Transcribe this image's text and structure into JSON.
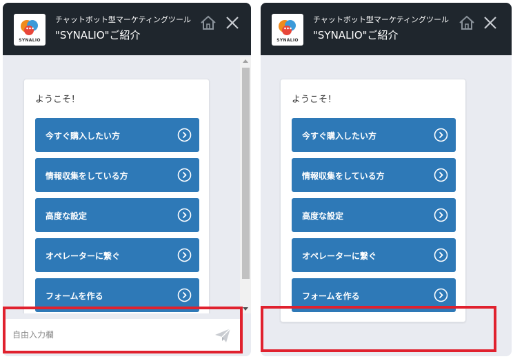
{
  "app": {
    "subtitle": "チャットボット型マーケティングツール",
    "title": "\"SYNALIO\"ご紹介",
    "logo_text": "SYNALIO"
  },
  "chat": {
    "welcome": "ようこそ！",
    "options": [
      {
        "label": "今すぐ購入したい方"
      },
      {
        "label": "情報収集をしている方"
      },
      {
        "label": "高度な設定"
      },
      {
        "label": "オペレーターに繋ぐ"
      },
      {
        "label": "フォームを作る"
      }
    ]
  },
  "input": {
    "placeholder": "自由入力欄"
  },
  "icons": {
    "home": "home-icon",
    "close": "close-icon",
    "send": "send-icon",
    "option_arrow": "chevron-right-circle-icon"
  },
  "colors": {
    "header_bg": "#1f262d",
    "body_bg": "#e9ebf1",
    "button_bg": "#2e79b7",
    "highlight": "#e0212e"
  }
}
